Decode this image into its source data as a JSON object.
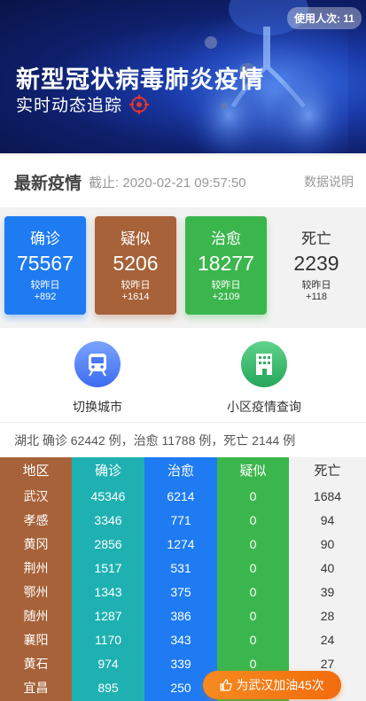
{
  "banner": {
    "title": "新型冠状病毒肺炎疫情",
    "subtitle": "实时动态追踪",
    "usage_label": "使用人次: 11"
  },
  "header": {
    "title": "最新疫情",
    "time": "截止: 2020-02-21 09:57:50",
    "link": "数据说明"
  },
  "stats": [
    {
      "label": "确诊",
      "value": "75567",
      "compare": "较昨日",
      "delta": "+892",
      "color": "#1e7bf2"
    },
    {
      "label": "疑似",
      "value": "5206",
      "compare": "较昨日",
      "delta": "+1614",
      "color": "#a76239"
    },
    {
      "label": "治愈",
      "value": "18277",
      "compare": "较昨日",
      "delta": "+2109",
      "color": "#3bb64d"
    },
    {
      "label": "死亡",
      "value": "2239",
      "compare": "较昨日",
      "delta": "+118",
      "color": "#f2f2f2"
    }
  ],
  "entries": {
    "city": {
      "label": "切换城市",
      "icon": "train-icon"
    },
    "community": {
      "label": "小区疫情查询",
      "icon": "building-icon"
    }
  },
  "summary": "湖北 确诊 62442 例，治愈 11788 例，死亡 2144 例",
  "table": {
    "headers": [
      "地区",
      "确诊",
      "治愈",
      "疑似",
      "死亡"
    ],
    "rows": [
      [
        "武汉",
        "45346",
        "6214",
        "0",
        "1684"
      ],
      [
        "孝感",
        "3346",
        "771",
        "0",
        "94"
      ],
      [
        "黄冈",
        "2856",
        "1274",
        "0",
        "90"
      ],
      [
        "荆州",
        "1517",
        "531",
        "0",
        "40"
      ],
      [
        "鄂州",
        "1343",
        "375",
        "0",
        "39"
      ],
      [
        "随州",
        "1287",
        "386",
        "0",
        "28"
      ],
      [
        "襄阳",
        "1170",
        "343",
        "0",
        "24"
      ],
      [
        "黄石",
        "974",
        "339",
        "0",
        "27"
      ],
      [
        "宜昌",
        "895",
        "250",
        "",
        ""
      ]
    ]
  },
  "cheer_button": {
    "label": "为武汉加油45次",
    "icon": "thumbs-up-icon"
  }
}
